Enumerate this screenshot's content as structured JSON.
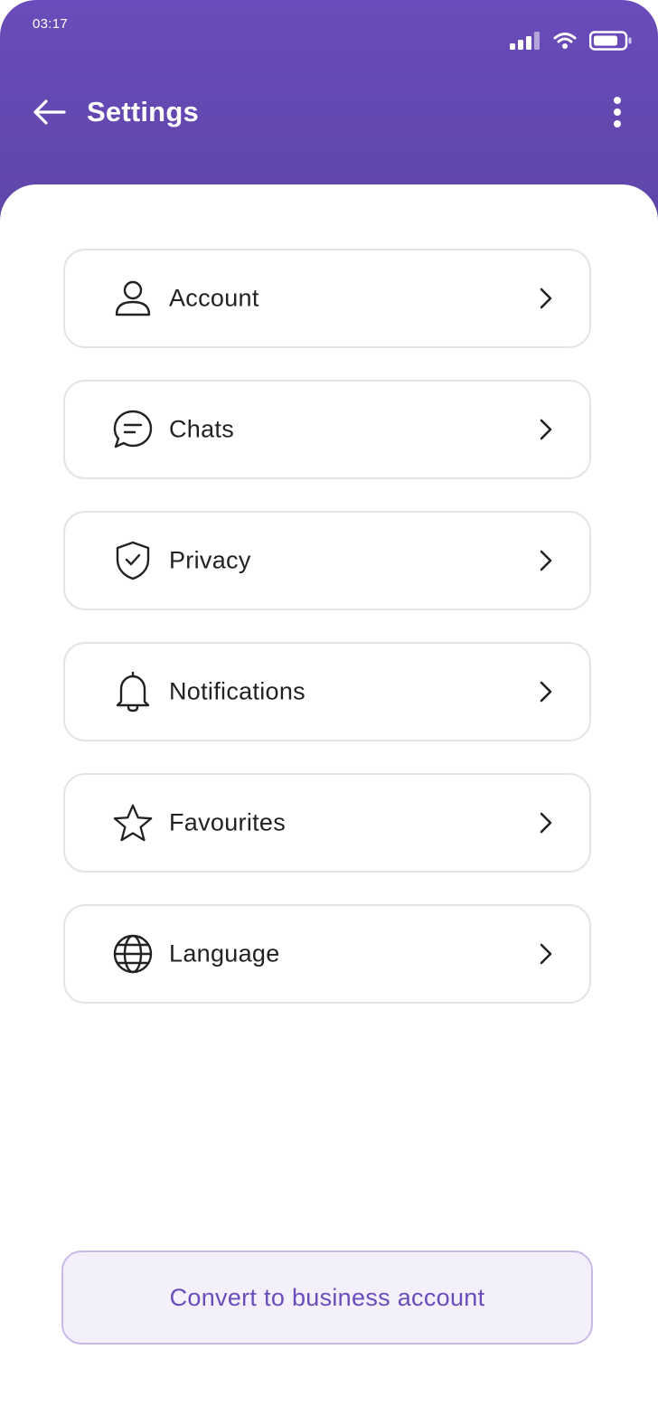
{
  "status_bar": {
    "time": "03:17"
  },
  "header": {
    "title": "Settings",
    "back_icon": "arrow-left-icon",
    "more_icon": "more-vertical-icon"
  },
  "menu": {
    "items": [
      {
        "label": "Account",
        "icon": "user-icon"
      },
      {
        "label": "Chats",
        "icon": "chat-bubble-icon"
      },
      {
        "label": "Privacy",
        "icon": "shield-check-icon"
      },
      {
        "label": "Notifications",
        "icon": "bell-icon"
      },
      {
        "label": "Favourites",
        "icon": "star-icon"
      },
      {
        "label": "Language",
        "icon": "globe-icon"
      }
    ],
    "chevron_icon": "chevron-right-icon"
  },
  "cta": {
    "label": "Convert to business account"
  },
  "colors": {
    "header_purple": "#6a4cba",
    "cta_text": "#6a4cba",
    "cta_background": "#f4f0fb",
    "card_border": "#e4e4e6",
    "text_primary": "#222222"
  }
}
